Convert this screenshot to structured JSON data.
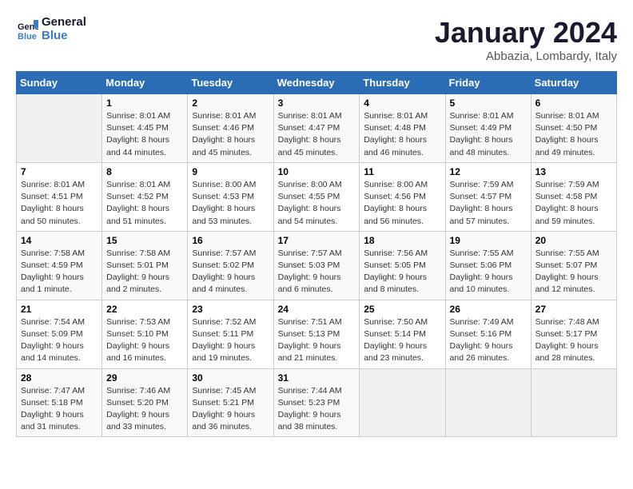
{
  "header": {
    "logo_line1": "General",
    "logo_line2": "Blue",
    "month": "January 2024",
    "location": "Abbazia, Lombardy, Italy"
  },
  "days_of_week": [
    "Sunday",
    "Monday",
    "Tuesday",
    "Wednesday",
    "Thursday",
    "Friday",
    "Saturday"
  ],
  "weeks": [
    [
      {
        "num": "",
        "sunrise": "",
        "sunset": "",
        "daylight": ""
      },
      {
        "num": "1",
        "sunrise": "Sunrise: 8:01 AM",
        "sunset": "Sunset: 4:45 PM",
        "daylight": "Daylight: 8 hours and 44 minutes."
      },
      {
        "num": "2",
        "sunrise": "Sunrise: 8:01 AM",
        "sunset": "Sunset: 4:46 PM",
        "daylight": "Daylight: 8 hours and 45 minutes."
      },
      {
        "num": "3",
        "sunrise": "Sunrise: 8:01 AM",
        "sunset": "Sunset: 4:47 PM",
        "daylight": "Daylight: 8 hours and 45 minutes."
      },
      {
        "num": "4",
        "sunrise": "Sunrise: 8:01 AM",
        "sunset": "Sunset: 4:48 PM",
        "daylight": "Daylight: 8 hours and 46 minutes."
      },
      {
        "num": "5",
        "sunrise": "Sunrise: 8:01 AM",
        "sunset": "Sunset: 4:49 PM",
        "daylight": "Daylight: 8 hours and 48 minutes."
      },
      {
        "num": "6",
        "sunrise": "Sunrise: 8:01 AM",
        "sunset": "Sunset: 4:50 PM",
        "daylight": "Daylight: 8 hours and 49 minutes."
      }
    ],
    [
      {
        "num": "7",
        "sunrise": "Sunrise: 8:01 AM",
        "sunset": "Sunset: 4:51 PM",
        "daylight": "Daylight: 8 hours and 50 minutes."
      },
      {
        "num": "8",
        "sunrise": "Sunrise: 8:01 AM",
        "sunset": "Sunset: 4:52 PM",
        "daylight": "Daylight: 8 hours and 51 minutes."
      },
      {
        "num": "9",
        "sunrise": "Sunrise: 8:00 AM",
        "sunset": "Sunset: 4:53 PM",
        "daylight": "Daylight: 8 hours and 53 minutes."
      },
      {
        "num": "10",
        "sunrise": "Sunrise: 8:00 AM",
        "sunset": "Sunset: 4:55 PM",
        "daylight": "Daylight: 8 hours and 54 minutes."
      },
      {
        "num": "11",
        "sunrise": "Sunrise: 8:00 AM",
        "sunset": "Sunset: 4:56 PM",
        "daylight": "Daylight: 8 hours and 56 minutes."
      },
      {
        "num": "12",
        "sunrise": "Sunrise: 7:59 AM",
        "sunset": "Sunset: 4:57 PM",
        "daylight": "Daylight: 8 hours and 57 minutes."
      },
      {
        "num": "13",
        "sunrise": "Sunrise: 7:59 AM",
        "sunset": "Sunset: 4:58 PM",
        "daylight": "Daylight: 8 hours and 59 minutes."
      }
    ],
    [
      {
        "num": "14",
        "sunrise": "Sunrise: 7:58 AM",
        "sunset": "Sunset: 4:59 PM",
        "daylight": "Daylight: 9 hours and 1 minute."
      },
      {
        "num": "15",
        "sunrise": "Sunrise: 7:58 AM",
        "sunset": "Sunset: 5:01 PM",
        "daylight": "Daylight: 9 hours and 2 minutes."
      },
      {
        "num": "16",
        "sunrise": "Sunrise: 7:57 AM",
        "sunset": "Sunset: 5:02 PM",
        "daylight": "Daylight: 9 hours and 4 minutes."
      },
      {
        "num": "17",
        "sunrise": "Sunrise: 7:57 AM",
        "sunset": "Sunset: 5:03 PM",
        "daylight": "Daylight: 9 hours and 6 minutes."
      },
      {
        "num": "18",
        "sunrise": "Sunrise: 7:56 AM",
        "sunset": "Sunset: 5:05 PM",
        "daylight": "Daylight: 9 hours and 8 minutes."
      },
      {
        "num": "19",
        "sunrise": "Sunrise: 7:55 AM",
        "sunset": "Sunset: 5:06 PM",
        "daylight": "Daylight: 9 hours and 10 minutes."
      },
      {
        "num": "20",
        "sunrise": "Sunrise: 7:55 AM",
        "sunset": "Sunset: 5:07 PM",
        "daylight": "Daylight: 9 hours and 12 minutes."
      }
    ],
    [
      {
        "num": "21",
        "sunrise": "Sunrise: 7:54 AM",
        "sunset": "Sunset: 5:09 PM",
        "daylight": "Daylight: 9 hours and 14 minutes."
      },
      {
        "num": "22",
        "sunrise": "Sunrise: 7:53 AM",
        "sunset": "Sunset: 5:10 PM",
        "daylight": "Daylight: 9 hours and 16 minutes."
      },
      {
        "num": "23",
        "sunrise": "Sunrise: 7:52 AM",
        "sunset": "Sunset: 5:11 PM",
        "daylight": "Daylight: 9 hours and 19 minutes."
      },
      {
        "num": "24",
        "sunrise": "Sunrise: 7:51 AM",
        "sunset": "Sunset: 5:13 PM",
        "daylight": "Daylight: 9 hours and 21 minutes."
      },
      {
        "num": "25",
        "sunrise": "Sunrise: 7:50 AM",
        "sunset": "Sunset: 5:14 PM",
        "daylight": "Daylight: 9 hours and 23 minutes."
      },
      {
        "num": "26",
        "sunrise": "Sunrise: 7:49 AM",
        "sunset": "Sunset: 5:16 PM",
        "daylight": "Daylight: 9 hours and 26 minutes."
      },
      {
        "num": "27",
        "sunrise": "Sunrise: 7:48 AM",
        "sunset": "Sunset: 5:17 PM",
        "daylight": "Daylight: 9 hours and 28 minutes."
      }
    ],
    [
      {
        "num": "28",
        "sunrise": "Sunrise: 7:47 AM",
        "sunset": "Sunset: 5:18 PM",
        "daylight": "Daylight: 9 hours and 31 minutes."
      },
      {
        "num": "29",
        "sunrise": "Sunrise: 7:46 AM",
        "sunset": "Sunset: 5:20 PM",
        "daylight": "Daylight: 9 hours and 33 minutes."
      },
      {
        "num": "30",
        "sunrise": "Sunrise: 7:45 AM",
        "sunset": "Sunset: 5:21 PM",
        "daylight": "Daylight: 9 hours and 36 minutes."
      },
      {
        "num": "31",
        "sunrise": "Sunrise: 7:44 AM",
        "sunset": "Sunset: 5:23 PM",
        "daylight": "Daylight: 9 hours and 38 minutes."
      },
      {
        "num": "",
        "sunrise": "",
        "sunset": "",
        "daylight": ""
      },
      {
        "num": "",
        "sunrise": "",
        "sunset": "",
        "daylight": ""
      },
      {
        "num": "",
        "sunrise": "",
        "sunset": "",
        "daylight": ""
      }
    ]
  ]
}
